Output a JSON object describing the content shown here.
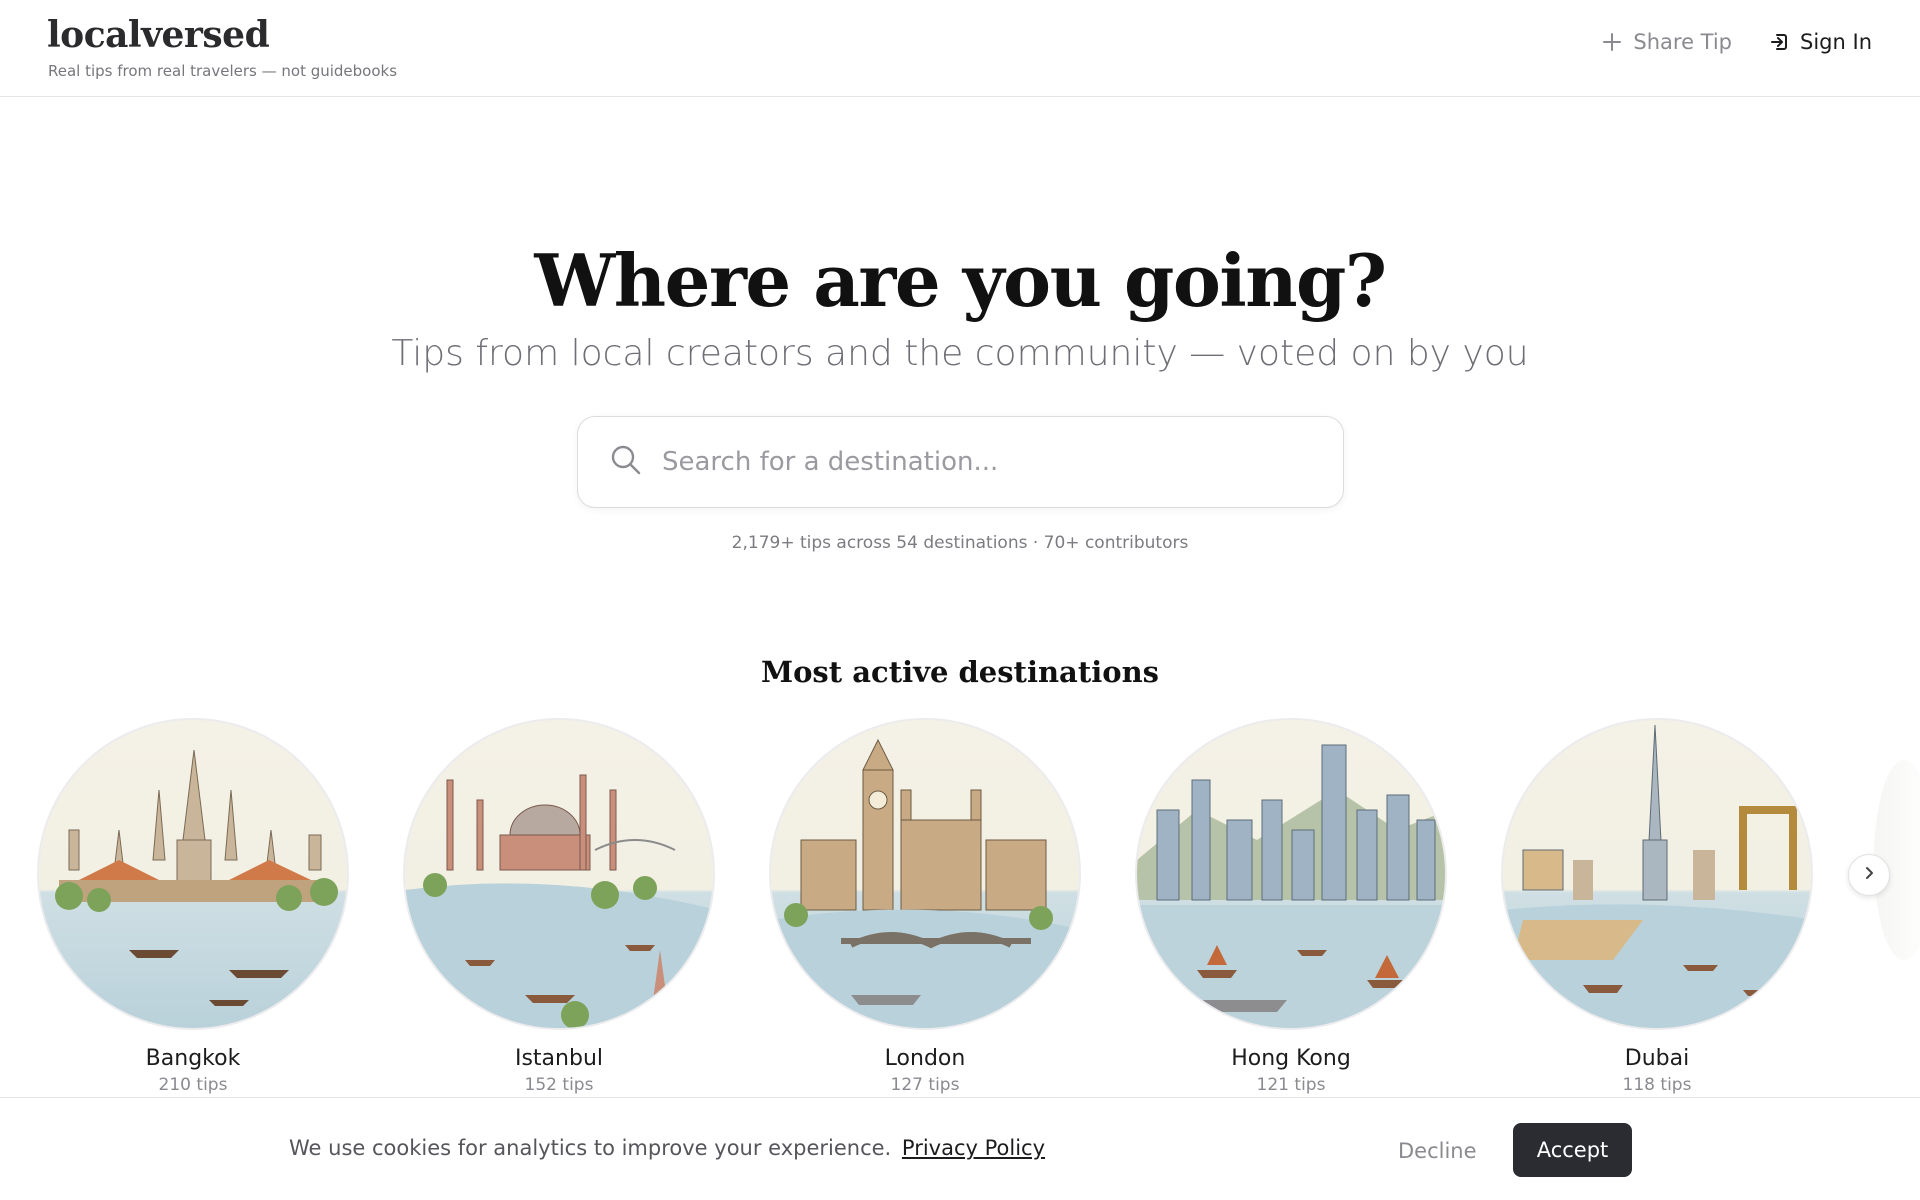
{
  "header": {
    "logo": "localversed",
    "tagline": "Real tips from real travelers — not guidebooks",
    "share_tip": {
      "label": "Share Tip",
      "icon": "plus-icon"
    },
    "sign_in": {
      "label": "Sign In",
      "icon": "sign-in-icon"
    }
  },
  "hero": {
    "title": "Where are you going?",
    "subtitle": "Tips from local creators and the community — voted on by you",
    "search": {
      "placeholder": "Search for a destination...",
      "value": "",
      "icon": "search-icon"
    },
    "stats": "2,179+ tips across 54 destinations · 70+ contributors"
  },
  "destinations": {
    "title": "Most active destinations",
    "items": [
      {
        "name": "Bangkok",
        "tips": "210 tips"
      },
      {
        "name": "Istanbul",
        "tips": "152 tips"
      },
      {
        "name": "London",
        "tips": "127 tips"
      },
      {
        "name": "Hong Kong",
        "tips": "121 tips"
      },
      {
        "name": "Dubai",
        "tips": "118 tips"
      }
    ],
    "next_icon": "chevron-right-icon"
  },
  "cookie_banner": {
    "text": "We use cookies for analytics to improve your experience.",
    "link": "Privacy Policy",
    "decline": "Decline",
    "accept": "Accept"
  },
  "colors": {
    "accept_bg": "#2a2c31",
    "text_primary": "#1c1c1e",
    "text_muted": "#8a8a90"
  }
}
